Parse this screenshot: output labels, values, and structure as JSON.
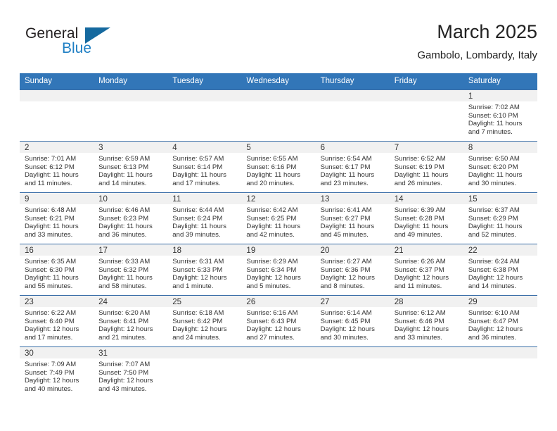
{
  "brand": {
    "name_top": "General",
    "name_bottom": "Blue",
    "triangle_color": "#15699f",
    "blue_color": "#1f7fc4"
  },
  "header": {
    "title": "March 2025",
    "subtitle": "Gambolo, Lombardy, Italy"
  },
  "theme": {
    "header_bg": "#3276b8",
    "row_border": "#3a6ea8",
    "daynum_bg": "#f1f1f1",
    "text": "#333333"
  },
  "labels": {
    "sunrise": "Sunrise:",
    "sunset": "Sunset:",
    "daylight": "Daylight:"
  },
  "weekdays": [
    "Sunday",
    "Monday",
    "Tuesday",
    "Wednesday",
    "Thursday",
    "Friday",
    "Saturday"
  ],
  "weeks": [
    [
      {
        "day": "",
        "empty": true
      },
      {
        "day": "",
        "empty": true
      },
      {
        "day": "",
        "empty": true
      },
      {
        "day": "",
        "empty": true
      },
      {
        "day": "",
        "empty": true
      },
      {
        "day": "",
        "empty": true
      },
      {
        "day": "1",
        "sunrise": "Sunrise: 7:02 AM",
        "sunset": "Sunset: 6:10 PM",
        "daylight1": "Daylight: 11 hours",
        "daylight2": "and 7 minutes."
      }
    ],
    [
      {
        "day": "2",
        "sunrise": "Sunrise: 7:01 AM",
        "sunset": "Sunset: 6:12 PM",
        "daylight1": "Daylight: 11 hours",
        "daylight2": "and 11 minutes."
      },
      {
        "day": "3",
        "sunrise": "Sunrise: 6:59 AM",
        "sunset": "Sunset: 6:13 PM",
        "daylight1": "Daylight: 11 hours",
        "daylight2": "and 14 minutes."
      },
      {
        "day": "4",
        "sunrise": "Sunrise: 6:57 AM",
        "sunset": "Sunset: 6:14 PM",
        "daylight1": "Daylight: 11 hours",
        "daylight2": "and 17 minutes."
      },
      {
        "day": "5",
        "sunrise": "Sunrise: 6:55 AM",
        "sunset": "Sunset: 6:16 PM",
        "daylight1": "Daylight: 11 hours",
        "daylight2": "and 20 minutes."
      },
      {
        "day": "6",
        "sunrise": "Sunrise: 6:54 AM",
        "sunset": "Sunset: 6:17 PM",
        "daylight1": "Daylight: 11 hours",
        "daylight2": "and 23 minutes."
      },
      {
        "day": "7",
        "sunrise": "Sunrise: 6:52 AM",
        "sunset": "Sunset: 6:19 PM",
        "daylight1": "Daylight: 11 hours",
        "daylight2": "and 26 minutes."
      },
      {
        "day": "8",
        "sunrise": "Sunrise: 6:50 AM",
        "sunset": "Sunset: 6:20 PM",
        "daylight1": "Daylight: 11 hours",
        "daylight2": "and 30 minutes."
      }
    ],
    [
      {
        "day": "9",
        "sunrise": "Sunrise: 6:48 AM",
        "sunset": "Sunset: 6:21 PM",
        "daylight1": "Daylight: 11 hours",
        "daylight2": "and 33 minutes."
      },
      {
        "day": "10",
        "sunrise": "Sunrise: 6:46 AM",
        "sunset": "Sunset: 6:23 PM",
        "daylight1": "Daylight: 11 hours",
        "daylight2": "and 36 minutes."
      },
      {
        "day": "11",
        "sunrise": "Sunrise: 6:44 AM",
        "sunset": "Sunset: 6:24 PM",
        "daylight1": "Daylight: 11 hours",
        "daylight2": "and 39 minutes."
      },
      {
        "day": "12",
        "sunrise": "Sunrise: 6:42 AM",
        "sunset": "Sunset: 6:25 PM",
        "daylight1": "Daylight: 11 hours",
        "daylight2": "and 42 minutes."
      },
      {
        "day": "13",
        "sunrise": "Sunrise: 6:41 AM",
        "sunset": "Sunset: 6:27 PM",
        "daylight1": "Daylight: 11 hours",
        "daylight2": "and 45 minutes."
      },
      {
        "day": "14",
        "sunrise": "Sunrise: 6:39 AM",
        "sunset": "Sunset: 6:28 PM",
        "daylight1": "Daylight: 11 hours",
        "daylight2": "and 49 minutes."
      },
      {
        "day": "15",
        "sunrise": "Sunrise: 6:37 AM",
        "sunset": "Sunset: 6:29 PM",
        "daylight1": "Daylight: 11 hours",
        "daylight2": "and 52 minutes."
      }
    ],
    [
      {
        "day": "16",
        "sunrise": "Sunrise: 6:35 AM",
        "sunset": "Sunset: 6:30 PM",
        "daylight1": "Daylight: 11 hours",
        "daylight2": "and 55 minutes."
      },
      {
        "day": "17",
        "sunrise": "Sunrise: 6:33 AM",
        "sunset": "Sunset: 6:32 PM",
        "daylight1": "Daylight: 11 hours",
        "daylight2": "and 58 minutes."
      },
      {
        "day": "18",
        "sunrise": "Sunrise: 6:31 AM",
        "sunset": "Sunset: 6:33 PM",
        "daylight1": "Daylight: 12 hours",
        "daylight2": "and 1 minute."
      },
      {
        "day": "19",
        "sunrise": "Sunrise: 6:29 AM",
        "sunset": "Sunset: 6:34 PM",
        "daylight1": "Daylight: 12 hours",
        "daylight2": "and 5 minutes."
      },
      {
        "day": "20",
        "sunrise": "Sunrise: 6:27 AM",
        "sunset": "Sunset: 6:36 PM",
        "daylight1": "Daylight: 12 hours",
        "daylight2": "and 8 minutes."
      },
      {
        "day": "21",
        "sunrise": "Sunrise: 6:26 AM",
        "sunset": "Sunset: 6:37 PM",
        "daylight1": "Daylight: 12 hours",
        "daylight2": "and 11 minutes."
      },
      {
        "day": "22",
        "sunrise": "Sunrise: 6:24 AM",
        "sunset": "Sunset: 6:38 PM",
        "daylight1": "Daylight: 12 hours",
        "daylight2": "and 14 minutes."
      }
    ],
    [
      {
        "day": "23",
        "sunrise": "Sunrise: 6:22 AM",
        "sunset": "Sunset: 6:40 PM",
        "daylight1": "Daylight: 12 hours",
        "daylight2": "and 17 minutes."
      },
      {
        "day": "24",
        "sunrise": "Sunrise: 6:20 AM",
        "sunset": "Sunset: 6:41 PM",
        "daylight1": "Daylight: 12 hours",
        "daylight2": "and 21 minutes."
      },
      {
        "day": "25",
        "sunrise": "Sunrise: 6:18 AM",
        "sunset": "Sunset: 6:42 PM",
        "daylight1": "Daylight: 12 hours",
        "daylight2": "and 24 minutes."
      },
      {
        "day": "26",
        "sunrise": "Sunrise: 6:16 AM",
        "sunset": "Sunset: 6:43 PM",
        "daylight1": "Daylight: 12 hours",
        "daylight2": "and 27 minutes."
      },
      {
        "day": "27",
        "sunrise": "Sunrise: 6:14 AM",
        "sunset": "Sunset: 6:45 PM",
        "daylight1": "Daylight: 12 hours",
        "daylight2": "and 30 minutes."
      },
      {
        "day": "28",
        "sunrise": "Sunrise: 6:12 AM",
        "sunset": "Sunset: 6:46 PM",
        "daylight1": "Daylight: 12 hours",
        "daylight2": "and 33 minutes."
      },
      {
        "day": "29",
        "sunrise": "Sunrise: 6:10 AM",
        "sunset": "Sunset: 6:47 PM",
        "daylight1": "Daylight: 12 hours",
        "daylight2": "and 36 minutes."
      }
    ],
    [
      {
        "day": "30",
        "sunrise": "Sunrise: 7:09 AM",
        "sunset": "Sunset: 7:49 PM",
        "daylight1": "Daylight: 12 hours",
        "daylight2": "and 40 minutes."
      },
      {
        "day": "31",
        "sunrise": "Sunrise: 7:07 AM",
        "sunset": "Sunset: 7:50 PM",
        "daylight1": "Daylight: 12 hours",
        "daylight2": "and 43 minutes."
      },
      {
        "day": "",
        "empty": true
      },
      {
        "day": "",
        "empty": true
      },
      {
        "day": "",
        "empty": true
      },
      {
        "day": "",
        "empty": true
      },
      {
        "day": "",
        "empty": true
      }
    ]
  ]
}
